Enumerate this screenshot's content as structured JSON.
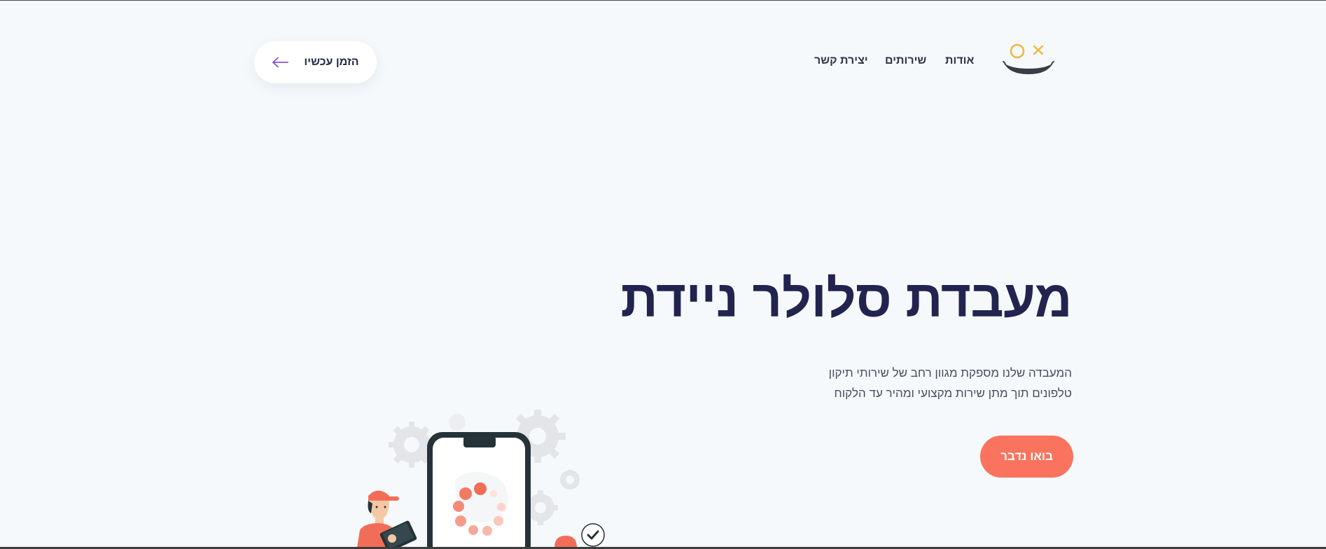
{
  "header": {
    "logo_icon": "smiley-wink-logo",
    "nav": {
      "about": "אודות",
      "services": "שירותים",
      "contact": "יצירת קשר"
    },
    "order_button": {
      "label": "הזמן עכשיו",
      "icon": "arrow-left-icon"
    }
  },
  "hero": {
    "title": "מעבדת סלולר ניידת",
    "description_line1": "המעבדה שלנו מספקת מגוון רחב של שירותי תיקון",
    "description_line2": "טלפונים תוך מתן שירות מקצועי ומהיר עד הלקוח",
    "cta_label": "בואו נדבר"
  },
  "colors": {
    "background": "#f5f9fc",
    "title": "#22244f",
    "accent": "#fa735e",
    "logo_yellow": "#f2b53a",
    "logo_dark": "#3a3d46",
    "arrow_purple": "#8a4fd6"
  }
}
